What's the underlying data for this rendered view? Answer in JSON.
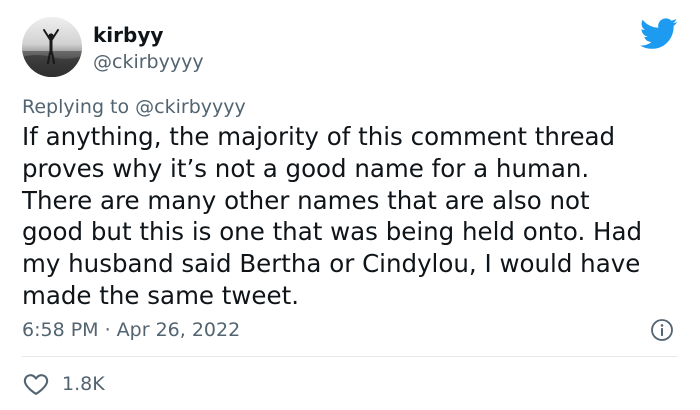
{
  "user": {
    "display_name": "kirbyy",
    "handle": "@ckirbyyyy"
  },
  "reply": {
    "prefix": "Replying to ",
    "mention": "@ckirbyyyy"
  },
  "tweet": {
    "text": "If anything, the majority of this comment thread\nproves why it’s not a good name for a human.\nThere are many other names that are also not\ngood but this is one that was being held onto. Had\nmy husband said Bertha or Cindylou, I would have\nmade the same tweet.",
    "timestamp": "6:58 PM · Apr 26, 2022"
  },
  "engagement": {
    "likes": "1.8K"
  },
  "icons": {
    "brand": "twitter-bird-icon",
    "info": "info-icon",
    "like": "heart-icon"
  },
  "colors": {
    "brand_blue": "#1d9bf0",
    "text_primary": "#0f1419",
    "text_secondary": "#536471",
    "divider": "#e6e9ec"
  }
}
